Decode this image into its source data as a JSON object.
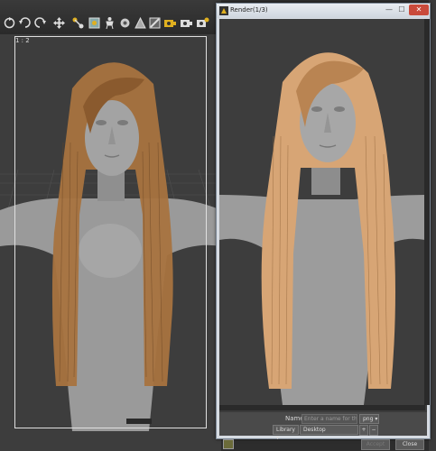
{
  "viewport": {
    "frame_label": "1 : 2"
  },
  "render_window": {
    "title": "Render(1/3)",
    "controls": {
      "name_label": "Name",
      "name_placeholder": "Enter a name for the im",
      "format_value": "png ▾",
      "location_value": "Library ▾",
      "destination_value": "Desktop",
      "add_label": "+",
      "remove_label": "−",
      "accept_label": "Accept",
      "close_label": "Close"
    }
  },
  "colors": {
    "viewport_bg": "#3d3d3d",
    "hair_viewport": "#a8733f",
    "hair_render": "#d7a575",
    "skin": "#9c9c9c",
    "title_close": "#c94a3b"
  }
}
